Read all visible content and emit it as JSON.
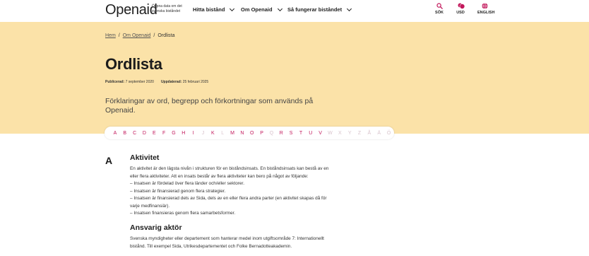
{
  "header": {
    "logo": "Openaid",
    "tagline": "Öppna data om det svenska biståndet",
    "nav": [
      {
        "label": "Hitta bistånd"
      },
      {
        "label": "Om Openaid"
      },
      {
        "label": "Så fungerar biståndet"
      }
    ],
    "utils": [
      {
        "label": "SÖK",
        "icon": "search-icon"
      },
      {
        "label": "USD",
        "icon": "currency-icon",
        "badge": "$"
      },
      {
        "label": "ENGLISH",
        "icon": "globe-icon"
      }
    ]
  },
  "breadcrumb": [
    "Hem",
    "Om Openaid",
    "Ordlista"
  ],
  "page": {
    "title": "Ordlista",
    "published_label": "Publicerad:",
    "published_date": "7 september 2020",
    "updated_label": "Uppdaterad:",
    "updated_date": "25 februari 2025",
    "lead": "Förklaringar av ord, begrepp och förkortningar som används på Openaid."
  },
  "alphabet": [
    {
      "l": "A",
      "on": true
    },
    {
      "l": "B",
      "on": true
    },
    {
      "l": "C",
      "on": true
    },
    {
      "l": "D",
      "on": true
    },
    {
      "l": "E",
      "on": true
    },
    {
      "l": "F",
      "on": true
    },
    {
      "l": "G",
      "on": true
    },
    {
      "l": "H",
      "on": true
    },
    {
      "l": "I",
      "on": true
    },
    {
      "l": "J",
      "on": false
    },
    {
      "l": "K",
      "on": true
    },
    {
      "l": "L",
      "on": false
    },
    {
      "l": "M",
      "on": true
    },
    {
      "l": "N",
      "on": true
    },
    {
      "l": "O",
      "on": true
    },
    {
      "l": "P",
      "on": true
    },
    {
      "l": "Q",
      "on": false
    },
    {
      "l": "R",
      "on": true
    },
    {
      "l": "S",
      "on": true
    },
    {
      "l": "T",
      "on": true
    },
    {
      "l": "U",
      "on": true
    },
    {
      "l": "V",
      "on": true
    },
    {
      "l": "W",
      "on": false
    },
    {
      "l": "X",
      "on": false
    },
    {
      "l": "Y",
      "on": false
    },
    {
      "l": "Z",
      "on": false
    },
    {
      "l": "Å",
      "on": false
    },
    {
      "l": "Ä",
      "on": false
    },
    {
      "l": "Ö",
      "on": false
    }
  ],
  "section": {
    "letter": "A",
    "terms": [
      {
        "title": "Aktivitet",
        "lines": [
          "En aktivitet är den lägsta nivån i strukturen för en biståndsinsats. En biståndsinsats kan bestå av en",
          "eller flera aktiviteter. Att en insats består av flera aktiviteter kan bero på något av följande:",
          "– Insatsen är fördelad över flera länder och/eller sektorer.",
          "– Insatsen är finansierad genom flera strategier.",
          "– Insatsen är finansierad dels av Sida, dels av en eller flera andra parter (en aktivitet skapas då för",
          "varje medfinansiär).",
          "– Insatsen finansieras genom flera samarbetsformer."
        ]
      },
      {
        "title": "Ansvarig aktör",
        "lines": [
          "Svenska myndigheter eller departement som hanterar medel inom utgiftsområde 7: Internationellt",
          "bistånd. Till exempel Sida, Utrikesdepartementet och Folke Bernadotteakademin."
        ]
      }
    ]
  },
  "colors": {
    "hero_bg": "#fbe2a8",
    "accent": "#c2185b",
    "letter_disabled": "#d9c3cc"
  }
}
